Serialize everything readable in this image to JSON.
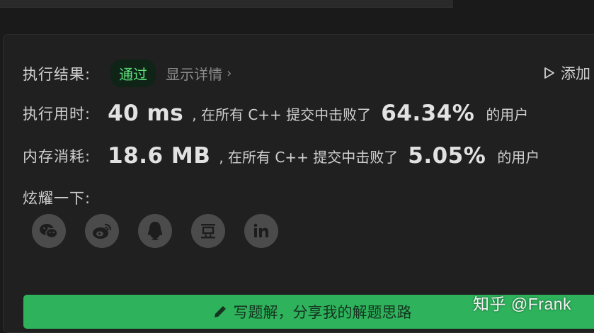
{
  "result": {
    "label": "执行结果:",
    "status": "通过",
    "details_link": "显示详情",
    "add_label": "添加"
  },
  "runtime": {
    "label": "执行用时:",
    "value": "40 ms",
    "mid_text": ", 在所有 C++ 提交中击败了",
    "percent": "64.34%",
    "suffix": "的用户"
  },
  "memory": {
    "label": "内存消耗:",
    "value": "18.6 MB",
    "mid_text": ", 在所有 C++ 提交中击败了",
    "percent": "5.05%",
    "suffix": "的用户"
  },
  "share": {
    "label": "炫耀一下:",
    "icons": [
      "wechat-icon",
      "weibo-icon",
      "qq-icon",
      "douban-icon",
      "linkedin-icon"
    ]
  },
  "solution_button": {
    "label": "写题解，分享我的解题思路"
  },
  "watermark": "知乎 @Frank",
  "colors": {
    "pass_green": "#5ce27c",
    "button_green": "#2eb35c",
    "icon_bg": "#4b4b4b"
  }
}
